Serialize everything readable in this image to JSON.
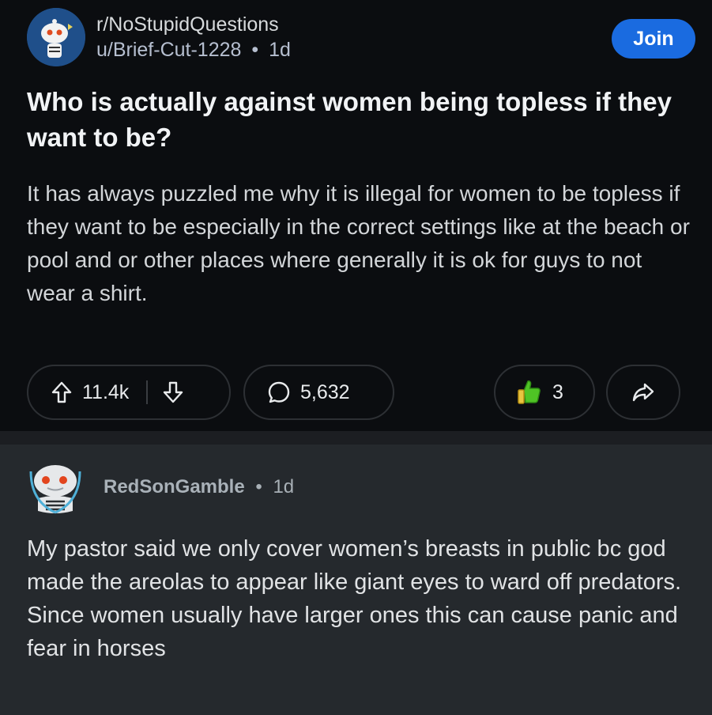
{
  "post": {
    "subreddit": "r/NoStupidQuestions",
    "author": "u/Brief-Cut-1228",
    "separator": "•",
    "age": "1d",
    "join_label": "Join",
    "title": "Who is actually against women being topless if they want to be?",
    "body": "It has always puzzled me why it is illegal for women to be topless if they want to be especially in the correct settings like at the beach or pool and or other places where generally it is ok for guys to not wear a shirt.",
    "upvotes": "11.4k",
    "comments": "5,632",
    "awards": "3"
  },
  "comment": {
    "author": "RedSonGamble",
    "separator": "•",
    "age": "1d",
    "text": "My pastor said we only cover women’s breasts in public bc god made the areolas to appear like giant eyes to ward off predators. Since women usually have larger ones this can cause panic and fear in horses"
  },
  "colors": {
    "accent": "#1a6be0",
    "background": "#0b0d10",
    "comment_background": "#25292d"
  }
}
